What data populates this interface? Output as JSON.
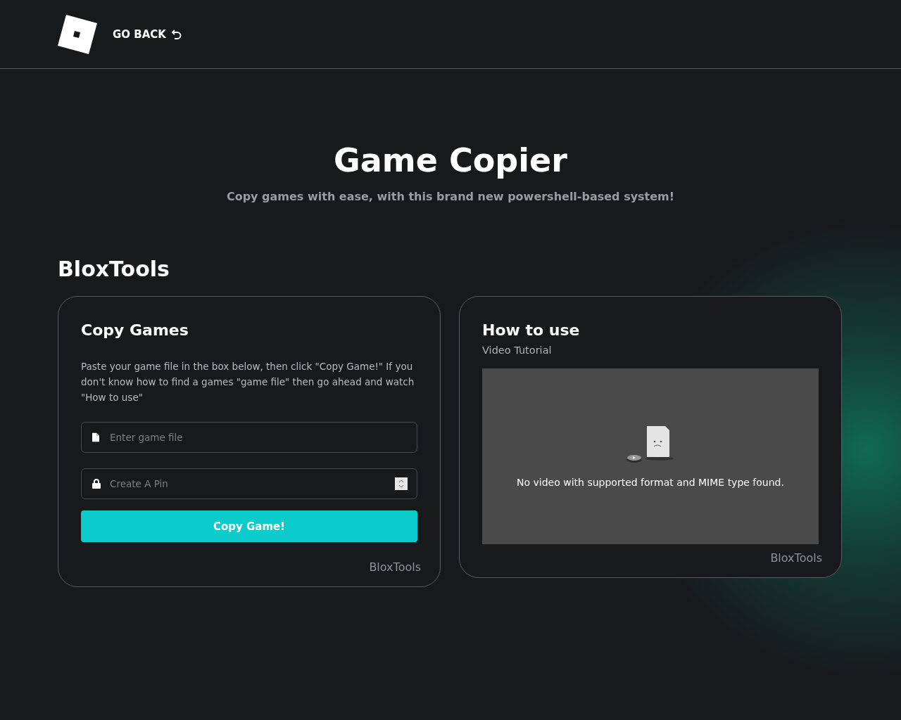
{
  "header": {
    "back_link": "GO BACK"
  },
  "hero": {
    "title": "Game Copier",
    "subtitle": "Copy games with ease, with this brand new powershell-based system!"
  },
  "section_title": "BloxTools",
  "copy_card": {
    "title": "Copy Games",
    "description": "Paste your game file in the box below, then click \"Copy Game!\" If you don't know how to find a games \"game file\" then go ahead and watch \"How to use\"",
    "fields": [
      {
        "kind": "file",
        "placeholder": "Enter game file"
      },
      {
        "kind": "pin",
        "placeholder": "Create A Pin"
      }
    ],
    "button": "Copy Game!",
    "footer": "BloxTools"
  },
  "video_card": {
    "title": "How to use",
    "subtitle": "Video Tutorial",
    "video_message": "No video with supported format and MIME type found.",
    "footer": "BloxTools"
  }
}
